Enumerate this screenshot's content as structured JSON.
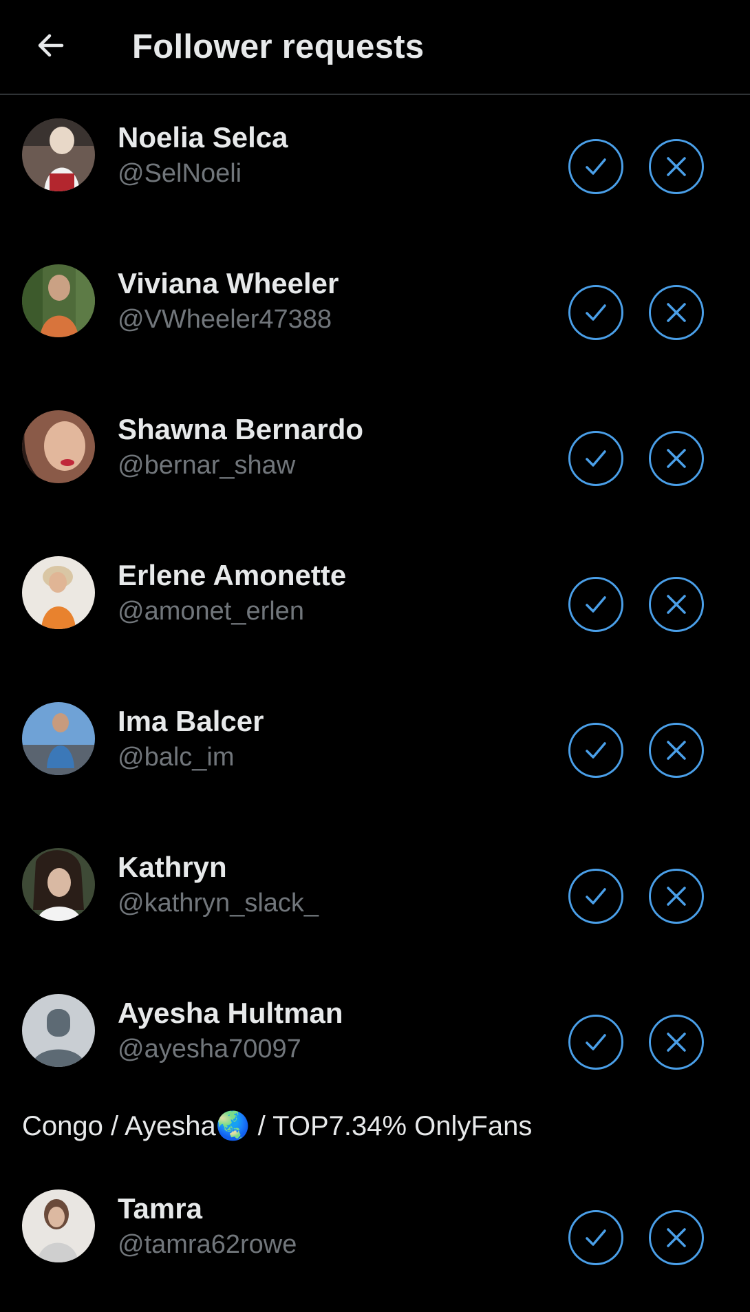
{
  "header": {
    "title": "Follower requests",
    "back_icon": "arrow-left-icon"
  },
  "requests": [
    {
      "name": "Noelia Selca",
      "handle": "@SelNoeli"
    },
    {
      "name": "Viviana Wheeler",
      "handle": "@VWheeler47388"
    },
    {
      "name": "Shawna Bernardo",
      "handle": "@bernar_shaw"
    },
    {
      "name": "Erlene Amonette",
      "handle": "@amonet_erlen"
    },
    {
      "name": "Ima Balcer",
      "handle": "@balc_im"
    },
    {
      "name": "Kathryn",
      "handle": "@kathryn_slack_"
    },
    {
      "name": "Ayesha Hultman",
      "handle": "@ayesha70097",
      "bio": "Congo / Ayesha🌏 / TOP7.34% OnlyFans"
    },
    {
      "name": "Tamra",
      "handle": "@tamra62rowe"
    }
  ],
  "icons": {
    "accept": "check-icon",
    "decline": "x-icon"
  },
  "colors": {
    "background": "#000000",
    "text_primary": "#e7e9ea",
    "text_secondary": "#71767b",
    "accent": "#4a9fe8",
    "divider": "#2f3336"
  }
}
